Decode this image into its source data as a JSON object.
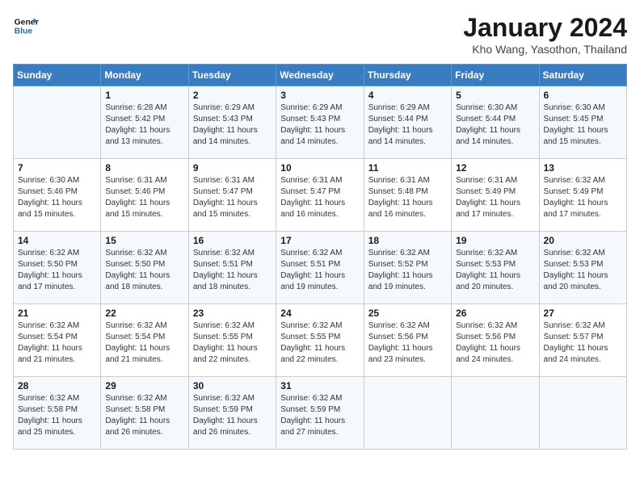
{
  "logo": {
    "line1": "General",
    "line2": "Blue"
  },
  "title": "January 2024",
  "subtitle": "Kho Wang, Yasothon, Thailand",
  "weekdays": [
    "Sunday",
    "Monday",
    "Tuesday",
    "Wednesday",
    "Thursday",
    "Friday",
    "Saturday"
  ],
  "weeks": [
    [
      {
        "day": "",
        "info": ""
      },
      {
        "day": "1",
        "info": "Sunrise: 6:28 AM\nSunset: 5:42 PM\nDaylight: 11 hours\nand 13 minutes."
      },
      {
        "day": "2",
        "info": "Sunrise: 6:29 AM\nSunset: 5:43 PM\nDaylight: 11 hours\nand 14 minutes."
      },
      {
        "day": "3",
        "info": "Sunrise: 6:29 AM\nSunset: 5:43 PM\nDaylight: 11 hours\nand 14 minutes."
      },
      {
        "day": "4",
        "info": "Sunrise: 6:29 AM\nSunset: 5:44 PM\nDaylight: 11 hours\nand 14 minutes."
      },
      {
        "day": "5",
        "info": "Sunrise: 6:30 AM\nSunset: 5:44 PM\nDaylight: 11 hours\nand 14 minutes."
      },
      {
        "day": "6",
        "info": "Sunrise: 6:30 AM\nSunset: 5:45 PM\nDaylight: 11 hours\nand 15 minutes."
      }
    ],
    [
      {
        "day": "7",
        "info": "Sunrise: 6:30 AM\nSunset: 5:46 PM\nDaylight: 11 hours\nand 15 minutes."
      },
      {
        "day": "8",
        "info": "Sunrise: 6:31 AM\nSunset: 5:46 PM\nDaylight: 11 hours\nand 15 minutes."
      },
      {
        "day": "9",
        "info": "Sunrise: 6:31 AM\nSunset: 5:47 PM\nDaylight: 11 hours\nand 15 minutes."
      },
      {
        "day": "10",
        "info": "Sunrise: 6:31 AM\nSunset: 5:47 PM\nDaylight: 11 hours\nand 16 minutes."
      },
      {
        "day": "11",
        "info": "Sunrise: 6:31 AM\nSunset: 5:48 PM\nDaylight: 11 hours\nand 16 minutes."
      },
      {
        "day": "12",
        "info": "Sunrise: 6:31 AM\nSunset: 5:49 PM\nDaylight: 11 hours\nand 17 minutes."
      },
      {
        "day": "13",
        "info": "Sunrise: 6:32 AM\nSunset: 5:49 PM\nDaylight: 11 hours\nand 17 minutes."
      }
    ],
    [
      {
        "day": "14",
        "info": "Sunrise: 6:32 AM\nSunset: 5:50 PM\nDaylight: 11 hours\nand 17 minutes."
      },
      {
        "day": "15",
        "info": "Sunrise: 6:32 AM\nSunset: 5:50 PM\nDaylight: 11 hours\nand 18 minutes."
      },
      {
        "day": "16",
        "info": "Sunrise: 6:32 AM\nSunset: 5:51 PM\nDaylight: 11 hours\nand 18 minutes."
      },
      {
        "day": "17",
        "info": "Sunrise: 6:32 AM\nSunset: 5:51 PM\nDaylight: 11 hours\nand 19 minutes."
      },
      {
        "day": "18",
        "info": "Sunrise: 6:32 AM\nSunset: 5:52 PM\nDaylight: 11 hours\nand 19 minutes."
      },
      {
        "day": "19",
        "info": "Sunrise: 6:32 AM\nSunset: 5:53 PM\nDaylight: 11 hours\nand 20 minutes."
      },
      {
        "day": "20",
        "info": "Sunrise: 6:32 AM\nSunset: 5:53 PM\nDaylight: 11 hours\nand 20 minutes."
      }
    ],
    [
      {
        "day": "21",
        "info": "Sunrise: 6:32 AM\nSunset: 5:54 PM\nDaylight: 11 hours\nand 21 minutes."
      },
      {
        "day": "22",
        "info": "Sunrise: 6:32 AM\nSunset: 5:54 PM\nDaylight: 11 hours\nand 21 minutes."
      },
      {
        "day": "23",
        "info": "Sunrise: 6:32 AM\nSunset: 5:55 PM\nDaylight: 11 hours\nand 22 minutes."
      },
      {
        "day": "24",
        "info": "Sunrise: 6:32 AM\nSunset: 5:55 PM\nDaylight: 11 hours\nand 22 minutes."
      },
      {
        "day": "25",
        "info": "Sunrise: 6:32 AM\nSunset: 5:56 PM\nDaylight: 11 hours\nand 23 minutes."
      },
      {
        "day": "26",
        "info": "Sunrise: 6:32 AM\nSunset: 5:56 PM\nDaylight: 11 hours\nand 24 minutes."
      },
      {
        "day": "27",
        "info": "Sunrise: 6:32 AM\nSunset: 5:57 PM\nDaylight: 11 hours\nand 24 minutes."
      }
    ],
    [
      {
        "day": "28",
        "info": "Sunrise: 6:32 AM\nSunset: 5:58 PM\nDaylight: 11 hours\nand 25 minutes."
      },
      {
        "day": "29",
        "info": "Sunrise: 6:32 AM\nSunset: 5:58 PM\nDaylight: 11 hours\nand 26 minutes."
      },
      {
        "day": "30",
        "info": "Sunrise: 6:32 AM\nSunset: 5:59 PM\nDaylight: 11 hours\nand 26 minutes."
      },
      {
        "day": "31",
        "info": "Sunrise: 6:32 AM\nSunset: 5:59 PM\nDaylight: 11 hours\nand 27 minutes."
      },
      {
        "day": "",
        "info": ""
      },
      {
        "day": "",
        "info": ""
      },
      {
        "day": "",
        "info": ""
      }
    ]
  ]
}
